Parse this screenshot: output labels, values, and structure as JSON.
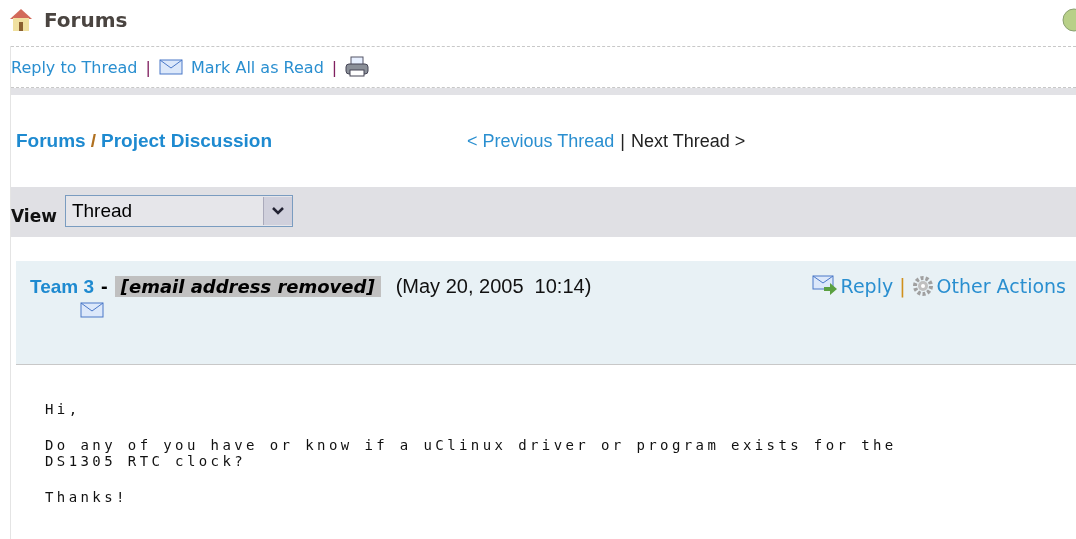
{
  "page_title": "Forums",
  "toolbar": {
    "links": [
      "Reply to Thread",
      "Mark All as Read"
    ],
    "separators": [
      "|",
      "|"
    ]
  },
  "breadcrumb": {
    "root": "Forums",
    "separator": "/",
    "current": "Project Discussion"
  },
  "thread_nav": {
    "previous": "< Previous Thread",
    "separator": "|",
    "next": "Next Thread >"
  },
  "view": {
    "label": "View",
    "value": "Thread"
  },
  "post": {
    "author": "Team 3",
    "dash": "-",
    "email": "[email address removed]",
    "date": "(May 20, 2005  10:14)",
    "actions": [
      "Reply",
      "Other Actions"
    ],
    "action_separator": "|",
    "body": [
      "Hi,",
      "Do any of you have or know if a uClinux driver or program exists for the\nDS1305 RTC clock?",
      "Thanks!"
    ]
  }
}
